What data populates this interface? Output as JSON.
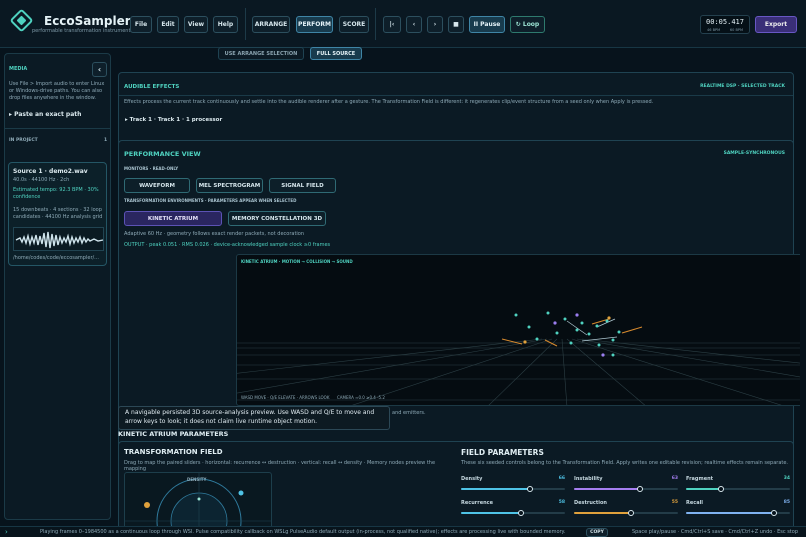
{
  "app": {
    "name": "EccoSampler",
    "subtitle": "performable transformation instrument"
  },
  "menu": [
    "File",
    "Edit",
    "View",
    "Help"
  ],
  "modes": [
    "ARRANGE",
    "PERFORM",
    "SCORE"
  ],
  "transport": {
    "first": "|‹",
    "prev": "‹",
    "next": "›",
    "stop": "■",
    "pause": "II Pause",
    "loop": "↻ Loop"
  },
  "clock": {
    "time": "00:05.417",
    "left_label": "46 BPM",
    "right_label": "60 BPM"
  },
  "export": "Export",
  "sidebar": {
    "title": "MEDIA",
    "collapse_icon": "‹",
    "help": "Use File > Import audio to enter Linux or Windows-drive paths. You can also drop files anywhere in the window.",
    "paste": "▸  Paste an exact path",
    "in_project": "IN PROJECT",
    "count": "1",
    "card": {
      "name": "Source 1 · demo2.wav",
      "meta": "40.0s · 44100 Hz · 2ch",
      "tempo": "Estimated tempo: 92.3 BPM · 30% confidence",
      "analysis": "15 downbeats · 4 sections · 32 loop candidates · 44100 Hz analysis grid",
      "path": "/home/codes/code/eccosampler/..."
    }
  },
  "source_tabs": [
    "USE ARRANGE SELECTION",
    "FULL SOURCE"
  ],
  "audible": {
    "title": "AUDIBLE EFFECTS",
    "badge": "REALTIME DSP · SELECTED TRACK",
    "desc": "Effects process the current track continuously and settle into the audible renderer after a gesture. The Transformation Field is different: it regenerates clip/event structure from a seed only when Apply is pressed.",
    "track": "▸  Track 1 · Track 1 · 1 processor"
  },
  "performance": {
    "title": "PERFORMANCE VIEW",
    "badge": "SAMPLE-SYNCHRONOUS",
    "monitors_label": "MONITORS · READ-ONLY",
    "monitors": [
      "WAVEFORM",
      "MEL SPECTROGRAM",
      "SIGNAL FIELD"
    ],
    "env_label": "TRANSFORMATION ENVIRONMENTS · PARAMETERS APPEAR WHEN SELECTED",
    "envs": [
      "KINETIC ATRIUM",
      "MEMORY CONSTELLATION 3D"
    ],
    "adaptive": "Adaptive 60 Hz · geometry follows exact render packets, not decoration",
    "output": "OUTPUT · peak 0.051 · RMS 0.026 · device-acknowledged sample clock ≥0 frames",
    "viewport_label": "KINETIC ATRIUM · MOTION → COLLISION → SOUND",
    "viewport_help": "WASD MOVE · Q/E ELEVATE · ARROWS LOOK",
    "camera": "CAMERA ≈0.0 ≥0.4 -5.2",
    "tooltip": "A navigable persisted 3D source-analysis preview. Use WASD and Q/E to move and arrow keys to look; it does not claim live runtime object motion.",
    "tooltip_tail": "and emitters."
  },
  "atrium_params_title": "KINETIC ATRIUM PARAMETERS",
  "transformation": {
    "title": "TRANSFORMATION FIELD",
    "desc": "Drag to map the paired sliders · horizontal: recurrence ↔ destruction · vertical: recall ↔ density · Memory nodes preview the mapping",
    "density_label": "DENSITY"
  },
  "field_params": {
    "title": "FIELD PARAMETERS",
    "desc": "These six seeded controls belong to the Transformation Field. Apply writes one editable revision; realtime effects remain separate.",
    "params": [
      {
        "label": "Density",
        "value": 66,
        "color": "#4fc3e6"
      },
      {
        "label": "Instability",
        "value": 63,
        "color": "#a57ef0"
      },
      {
        "label": "Fragment",
        "value": 34,
        "color": "#4fd2c0"
      },
      {
        "label": "Recurrence",
        "value": 58,
        "color": "#4fc3e6"
      },
      {
        "label": "Destruction",
        "value": 55,
        "color": "#e0a13c"
      },
      {
        "label": "Recall",
        "value": 85,
        "color": "#7fb2f0"
      }
    ]
  },
  "footer": {
    "status": "Playing frames 0–1984500 as a continuous loop through WSI. Pulse compatibility callback on WSLg PulseAudio default output (in-process, not qualified native); effects are processing live with bounded memory.",
    "copy": "COPY",
    "shortcuts": "Space play/pause · Cmd/Ctrl+S save · Cmd/Ctrl+Z undo · Esc stop"
  },
  "chart_data": {
    "type": "scatter",
    "title": "KINETIC ATRIUM · MOTION → COLLISION → SOUND",
    "points": []
  }
}
